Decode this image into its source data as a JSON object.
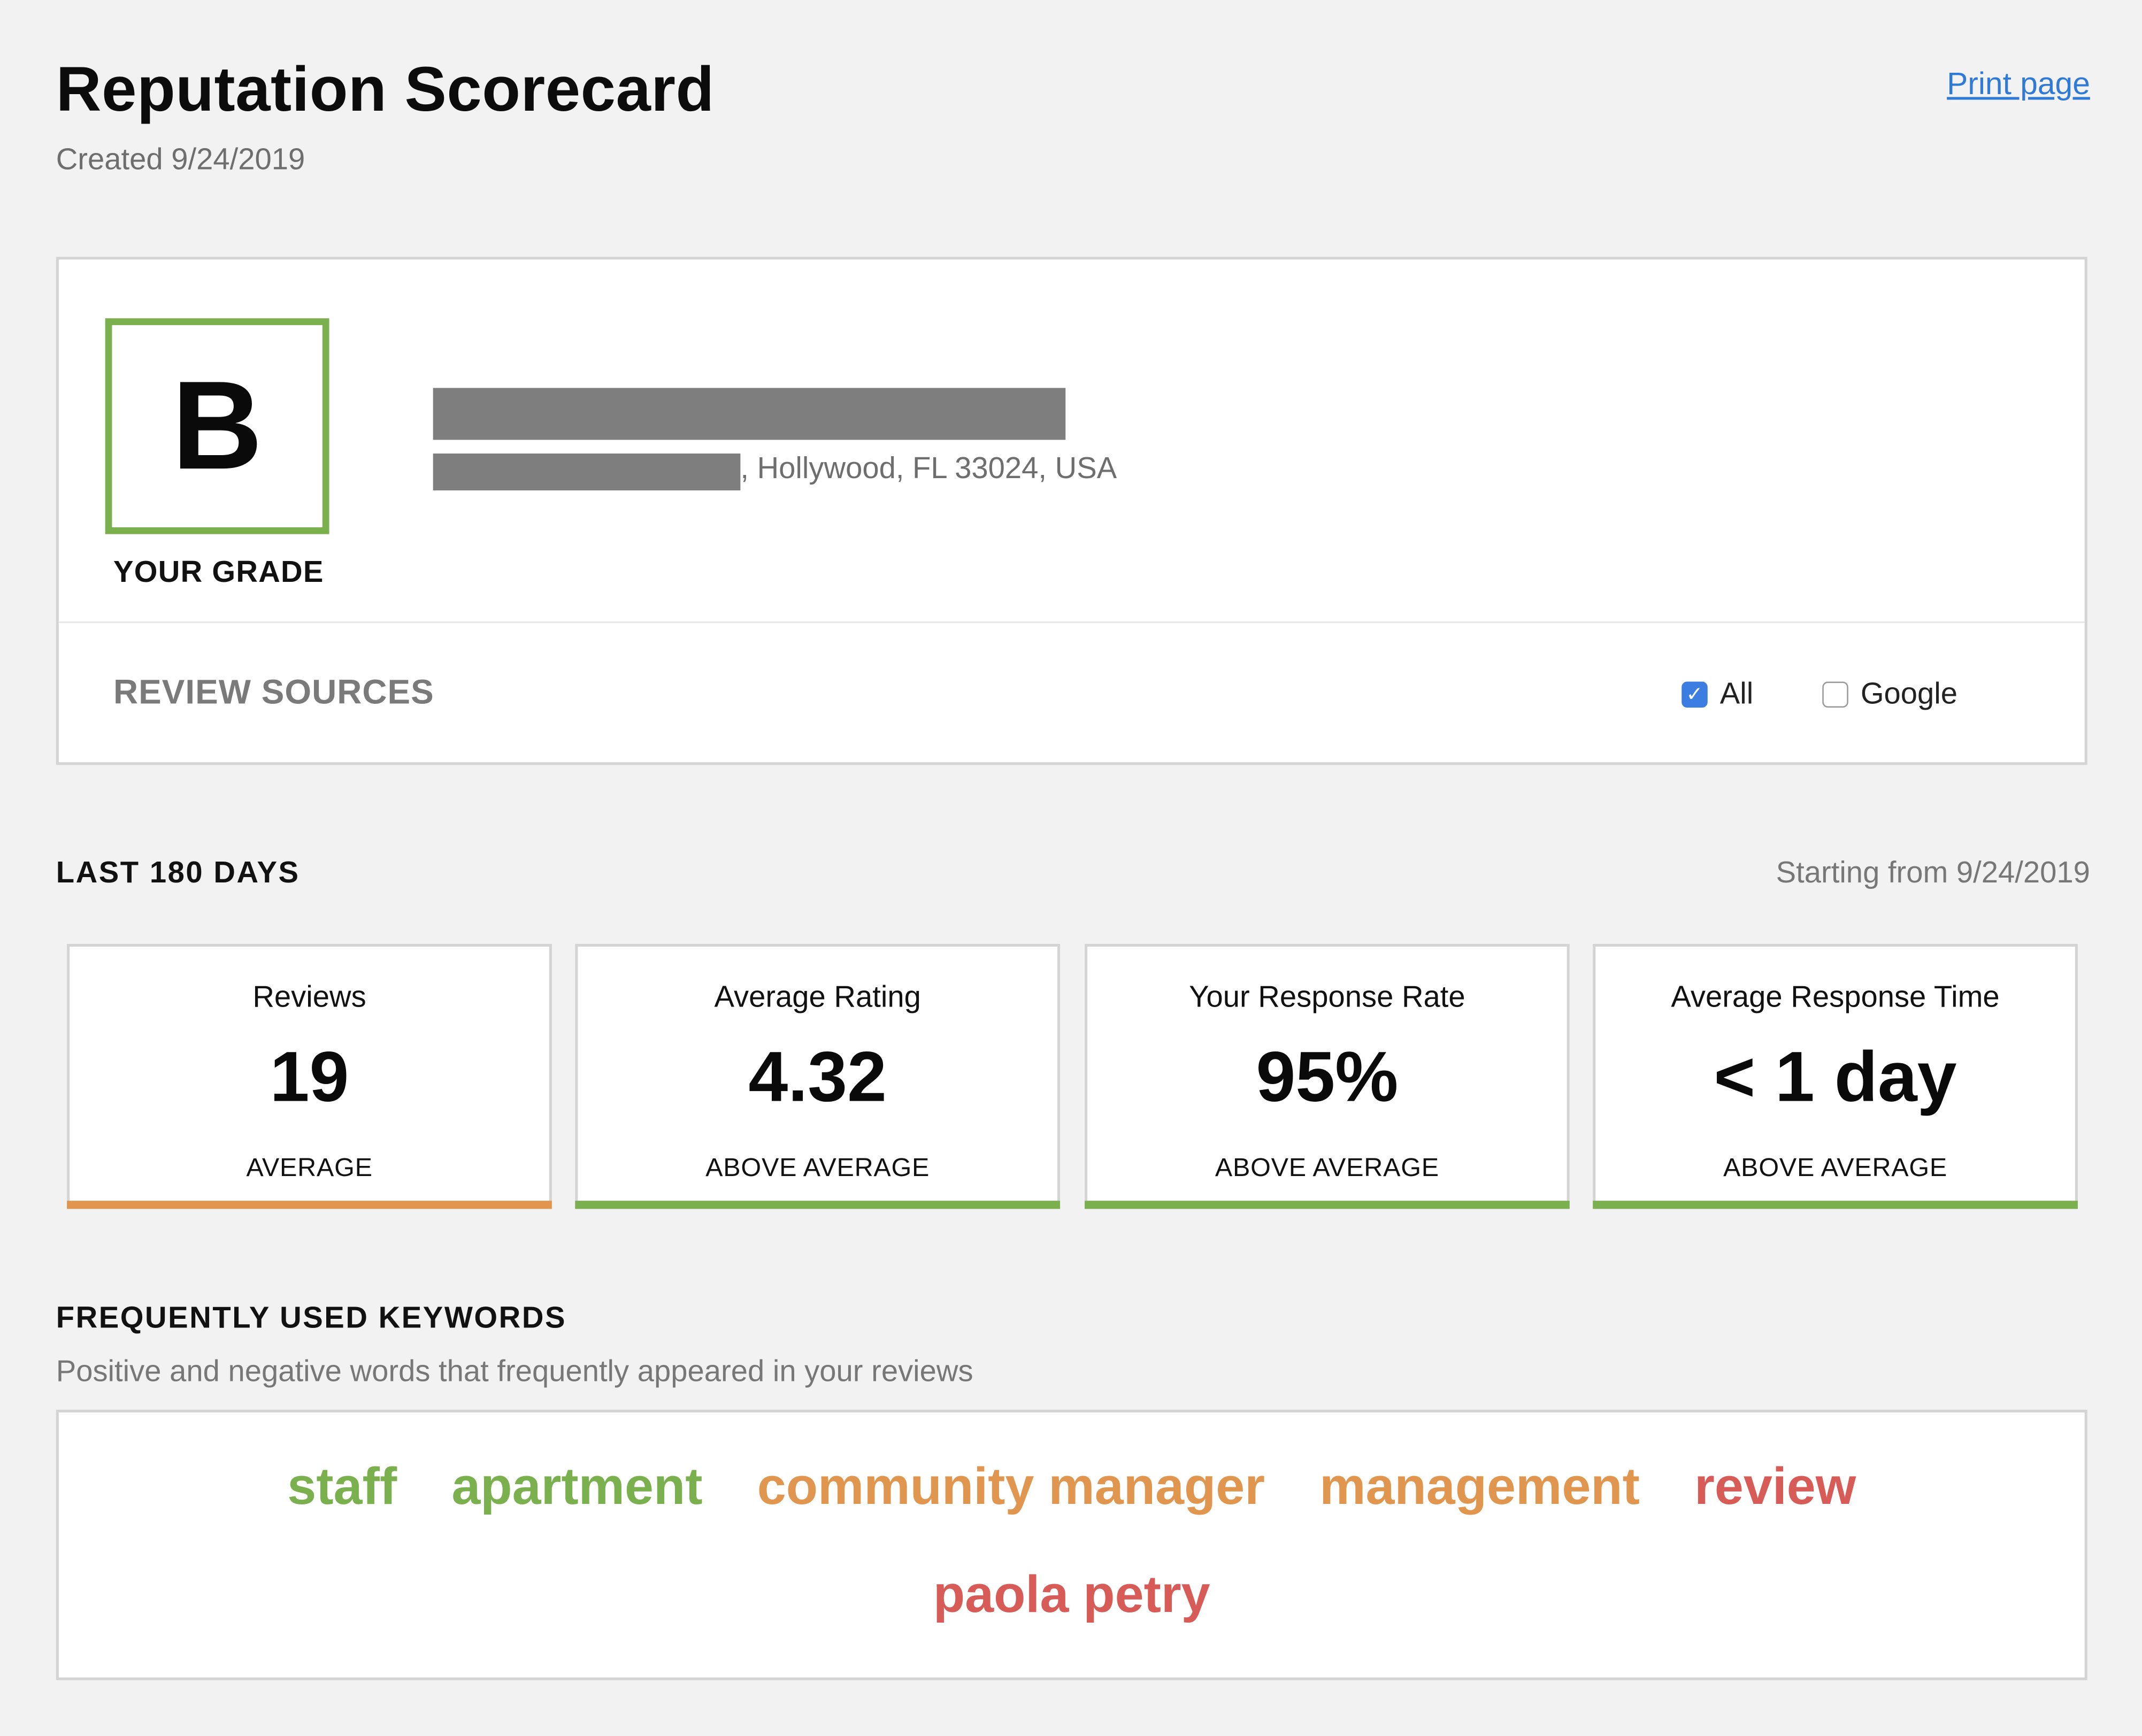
{
  "header": {
    "title": "Reputation Scorecard",
    "created": "Created 9/24/2019",
    "print_label": "Print page"
  },
  "grade": {
    "letter": "B",
    "label": "YOUR GRADE",
    "color": "#7bb04f"
  },
  "business": {
    "address_tail": ", Hollywood, FL 33024, USA"
  },
  "review_sources": {
    "label": "REVIEW SOURCES",
    "options": [
      {
        "label": "All",
        "checked": true
      },
      {
        "label": "Google",
        "checked": false
      }
    ]
  },
  "period": {
    "heading": "LAST 180 DAYS",
    "starting": "Starting from 9/24/2019"
  },
  "stats": [
    {
      "label": "Reviews",
      "value": "19",
      "status": "AVERAGE",
      "color": "#e0964f"
    },
    {
      "label": "Average Rating",
      "value": "4.32",
      "status": "ABOVE AVERAGE",
      "color": "#7bb04f"
    },
    {
      "label": "Your Response Rate",
      "value": "95%",
      "status": "ABOVE AVERAGE",
      "color": "#7bb04f"
    },
    {
      "label": "Average Response Time",
      "value": "< 1 day",
      "status": "ABOVE AVERAGE",
      "color": "#7bb04f"
    }
  ],
  "keywords": {
    "heading": "FREQUENTLY USED KEYWORDS",
    "subtitle": "Positive and negative words that frequently appeared in your reviews",
    "words": [
      {
        "text": "staff",
        "color": "#7bb04f"
      },
      {
        "text": "apartment",
        "color": "#7bb04f"
      },
      {
        "text": "community manager",
        "color": "#e0964f"
      },
      {
        "text": "management",
        "color": "#e0964f"
      },
      {
        "text": "review",
        "color": "#d75b57"
      },
      {
        "text": "paola petry",
        "color": "#d75b57"
      }
    ]
  }
}
